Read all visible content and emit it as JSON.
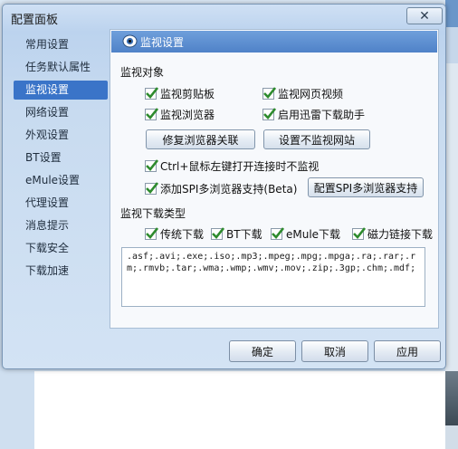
{
  "window": {
    "title": "配置面板",
    "close_icon": "close-icon"
  },
  "nav": {
    "items": [
      {
        "label": "常用设置"
      },
      {
        "label": "任务默认属性"
      },
      {
        "label": "监视设置"
      },
      {
        "label": "网络设置"
      },
      {
        "label": "外观设置"
      },
      {
        "label": "BT设置"
      },
      {
        "label": "eMule设置"
      },
      {
        "label": "代理设置"
      },
      {
        "label": "消息提示"
      },
      {
        "label": "下载安全"
      },
      {
        "label": "下载加速"
      }
    ],
    "active": "监视设置"
  },
  "panel": {
    "title": "监视设置",
    "icon": "eye-icon",
    "monitor_objects": {
      "label": "监视对象",
      "clipboard": {
        "label": "监视剪贴板",
        "checked": true
      },
      "web_video": {
        "label": "监视网页视频",
        "checked": true
      },
      "browser": {
        "label": "监视浏览器",
        "checked": true
      },
      "thunder_helper": {
        "label": "启用迅雷下载助手",
        "checked": true
      },
      "repair_button": "修复浏览器关联",
      "no_monitor_button": "设置不监视网站",
      "ctrl_click": {
        "label": "Ctrl+鼠标左键打开连接时不监视",
        "checked": true
      },
      "spi": {
        "label": "添加SPI多浏览器支持(Beta)",
        "checked": true
      },
      "spi_button": "配置SPI多浏览器支持"
    },
    "download_types": {
      "label": "监视下载类型",
      "traditional": {
        "label": "传统下载",
        "checked": true
      },
      "bt": {
        "label": "BT下载",
        "checked": true
      },
      "emule": {
        "label": "eMule下载",
        "checked": true
      },
      "magnet": {
        "label": "磁力链接下载",
        "checked": true
      },
      "extensions": ".asf;.avi;.exe;.iso;.mp3;.mpeg;.mpg;.mpga;.ra;.rar;.rm;.rmvb;.tar;.wma;.wmp;.wmv;.mov;.zip;.3gp;.chm;.mdf;"
    }
  },
  "footer": {
    "ok": "确定",
    "cancel": "取消",
    "apply": "应用"
  },
  "colors": {
    "accent": "#3a74c8",
    "check": "#2e8b2e",
    "header": "#4f82c8"
  }
}
